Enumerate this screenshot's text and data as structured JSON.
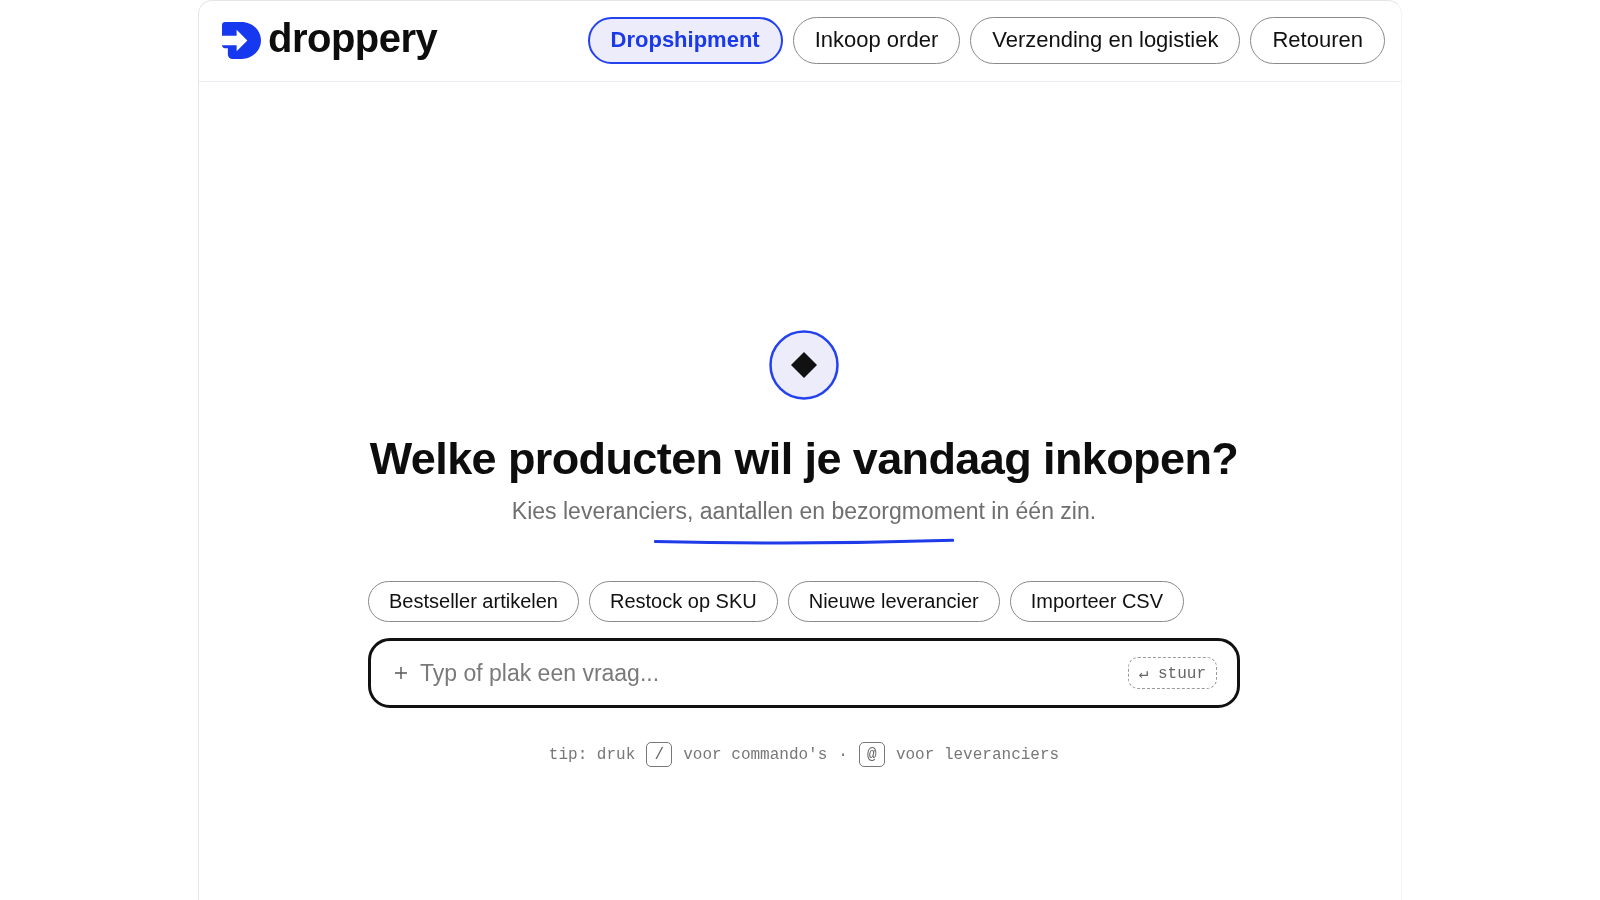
{
  "brand": {
    "name": "droppery"
  },
  "nav_tabs": [
    {
      "label": "Dropshipment",
      "selected": true
    },
    {
      "label": "Inkoop order",
      "selected": false
    },
    {
      "label": "Verzending en logistiek",
      "selected": false
    },
    {
      "label": "Retouren",
      "selected": false
    }
  ],
  "hero": {
    "title": "Welke producten wil je vandaag inkopen?",
    "subtitle": "Kies leveranciers, aantallen en bezorgmoment in één zin."
  },
  "suggestions": [
    "Bestseller artikelen",
    "Restock op SKU",
    "Nieuwe leverancier",
    "Importeer CSV"
  ],
  "composer": {
    "placeholder": "Typ of plak een vraag...",
    "send_label": "↵ stuur"
  },
  "tip": [
    {
      "kind": "text",
      "text": "tip: druk"
    },
    {
      "kind": "key",
      "text": "/"
    },
    {
      "kind": "text",
      "text": "voor commando's"
    },
    {
      "kind": "text",
      "text": "·"
    },
    {
      "kind": "key",
      "text": "@"
    },
    {
      "kind": "text",
      "text": "voor leveranciers"
    }
  ]
}
